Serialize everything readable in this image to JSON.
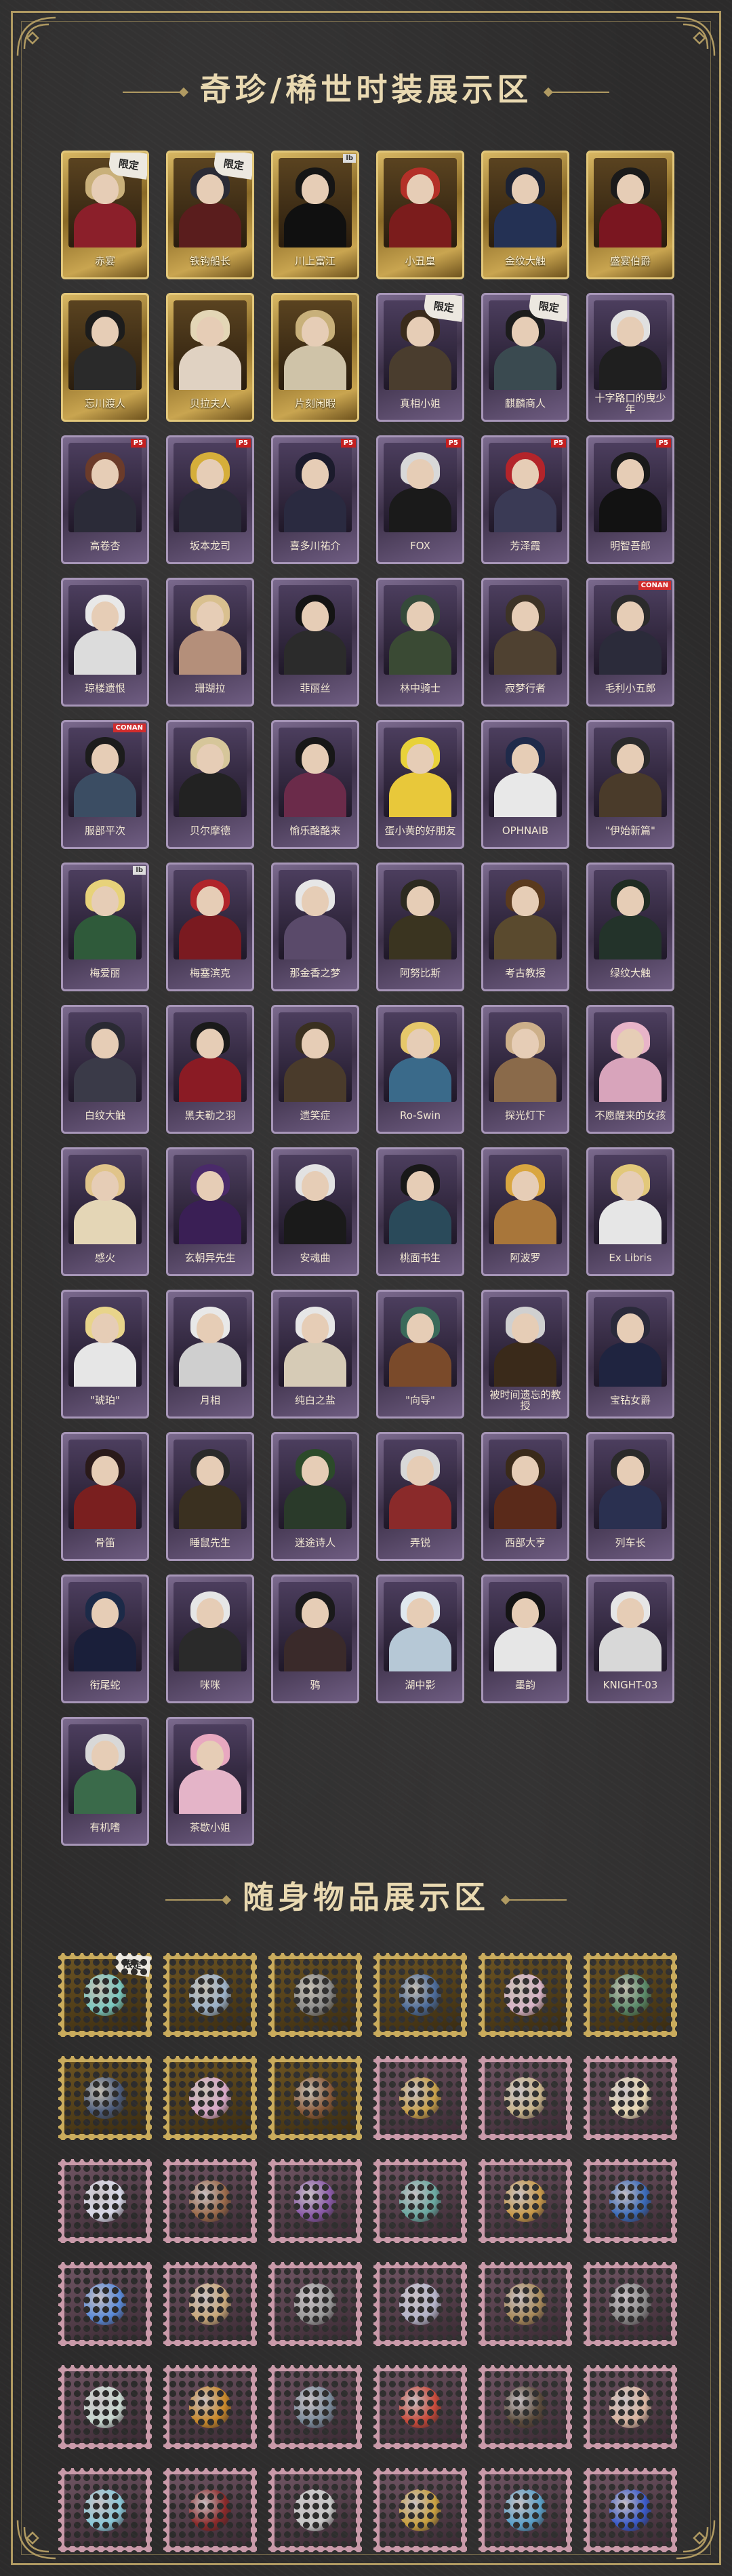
{
  "costumes_section": {
    "title": "奇珍/稀世时装展示区"
  },
  "items_section": {
    "title": "随身物品展示区"
  },
  "limited_tag": "限定",
  "badge_texts": {
    "p5": "P5",
    "conan": "CONAN",
    "lb": "lb"
  },
  "costumes": [
    {
      "name": "赤宴",
      "frame": "gold",
      "limited": true,
      "hair": "#c9b07a",
      "body": "#8b1f2a"
    },
    {
      "name": "铁钩船长",
      "frame": "gold",
      "limited": true,
      "hair": "#2b2b36",
      "body": "#5a1d1d"
    },
    {
      "name": "川上富江",
      "frame": "gold",
      "limited": false,
      "hair": "#151515",
      "body": "#101010",
      "badge": "lb"
    },
    {
      "name": "小丑皇",
      "frame": "gold",
      "limited": false,
      "hair": "#b33028",
      "body": "#7b1c1c"
    },
    {
      "name": "金纹大触",
      "frame": "gold",
      "limited": false,
      "hair": "#1c2233",
      "body": "#243154"
    },
    {
      "name": "盛宴伯爵",
      "frame": "gold",
      "limited": false,
      "hair": "#1a1a1a",
      "body": "#7a1620"
    },
    {
      "name": "忘川渡人",
      "frame": "gold",
      "limited": false,
      "hair": "#1c1c1c",
      "body": "#2a2a2a"
    },
    {
      "name": "贝拉夫人",
      "frame": "gold",
      "limited": false,
      "hair": "#e3d6b6",
      "body": "#e0d2c2"
    },
    {
      "name": "片刻闲暇",
      "frame": "gold",
      "limited": false,
      "hair": "#c8b07a",
      "body": "#cfc3a8"
    },
    {
      "name": "真相小姐",
      "frame": "purple",
      "limited": true,
      "hair": "#3a2b1c",
      "body": "#4a3d2e"
    },
    {
      "name": "麒麟商人",
      "frame": "purple",
      "limited": true,
      "hair": "#1c1c1c",
      "body": "#3a4a50"
    },
    {
      "name": "十字路口的曳少年",
      "frame": "purple",
      "limited": false,
      "hair": "#e0e0e0",
      "body": "#1f1f1f"
    },
    {
      "name": "高卷杏",
      "frame": "purple",
      "limited": false,
      "hair": "#6b3b2a",
      "body": "#2b2b38",
      "badge": "p5"
    },
    {
      "name": "坂本龙司",
      "frame": "purple",
      "limited": false,
      "hair": "#d5ae3a",
      "body": "#2a2a38",
      "badge": "p5"
    },
    {
      "name": "喜多川祐介",
      "frame": "purple",
      "limited": false,
      "hair": "#1b1b2c",
      "body": "#2a2a40",
      "badge": "p5"
    },
    {
      "name": "FOX",
      "frame": "purple",
      "limited": false,
      "hair": "#d8d8d8",
      "body": "#1a1a1a",
      "badge": "p5"
    },
    {
      "name": "芳泽霞",
      "frame": "purple",
      "limited": false,
      "hair": "#b3242a",
      "body": "#3a3a55",
      "badge": "p5"
    },
    {
      "name": "明智吾郎",
      "frame": "purple",
      "limited": false,
      "hair": "#1a1a1a",
      "body": "#121212",
      "badge": "p5"
    },
    {
      "name": "琼楼遗恨",
      "frame": "purple",
      "limited": false,
      "hair": "#e8e8e8",
      "body": "#dcdcdc"
    },
    {
      "name": "珊瑚拉",
      "frame": "purple",
      "limited": false,
      "hair": "#d9c08f",
      "body": "#b48f7a"
    },
    {
      "name": "菲丽丝",
      "frame": "purple",
      "limited": false,
      "hair": "#141414",
      "body": "#2b2b2b"
    },
    {
      "name": "林中骑士",
      "frame": "purple",
      "limited": false,
      "hair": "#354a3a",
      "body": "#3a4a34"
    },
    {
      "name": "寂梦行者",
      "frame": "purple",
      "limited": false,
      "hair": "#3d3326",
      "body": "#4f4131"
    },
    {
      "name": "毛利小五郎",
      "frame": "purple",
      "limited": false,
      "hair": "#2b2b2b",
      "body": "#2b2b3a",
      "badge": "conan"
    },
    {
      "name": "服部平次",
      "frame": "purple",
      "limited": false,
      "hair": "#1c1c1c",
      "body": "#3b4d63",
      "badge": "conan"
    },
    {
      "name": "贝尔摩德",
      "frame": "purple",
      "limited": false,
      "hair": "#d6c69a",
      "body": "#222222"
    },
    {
      "name": "愉乐酪酪来",
      "frame": "purple",
      "limited": false,
      "hair": "#171717",
      "body": "#6b2b4a"
    },
    {
      "name": "蛋小黄的好朋友",
      "frame": "purple",
      "limited": false,
      "hair": "#e8d23a",
      "body": "#e8c83a"
    },
    {
      "name": "OPHNAIB",
      "frame": "purple",
      "limited": false,
      "hair": "#1f2a4a",
      "body": "#e8e8e8"
    },
    {
      "name": "\"伊始新篇\"",
      "frame": "purple",
      "limited": false,
      "hair": "#2a2a2a",
      "body": "#4a3b2a"
    },
    {
      "name": "梅爱丽",
      "frame": "purple",
      "limited": false,
      "hair": "#e7d27a",
      "body": "#2f5a3a",
      "badge": "lb"
    },
    {
      "name": "梅塞滨克",
      "frame": "purple",
      "limited": false,
      "hair": "#b0242a",
      "body": "#7a1a20"
    },
    {
      "name": "那金香之梦",
      "frame": "purple",
      "limited": false,
      "hair": "#e6e6e6",
      "body": "#5a4a6a"
    },
    {
      "name": "阿努比斯",
      "frame": "purple",
      "limited": false,
      "hair": "#2c2a20",
      "body": "#3a3420"
    },
    {
      "name": "考古教授",
      "frame": "purple",
      "limited": false,
      "hair": "#5a3a1e",
      "body": "#5a4a2e"
    },
    {
      "name": "绿纹大触",
      "frame": "purple",
      "limited": false,
      "hair": "#1f2c22",
      "body": "#23332a"
    },
    {
      "name": "白纹大触",
      "frame": "purple",
      "limited": false,
      "hair": "#2a2a33",
      "body": "#3a3a48"
    },
    {
      "name": "黑夫勒之羽",
      "frame": "purple",
      "limited": false,
      "hair": "#1a1a1a",
      "body": "#8a1b24"
    },
    {
      "name": "遗笑症",
      "frame": "purple",
      "limited": false,
      "hair": "#3a3020",
      "body": "#4a3b2b"
    },
    {
      "name": "Ro-Swin",
      "frame": "purple",
      "limited": false,
      "hair": "#e6c86a",
      "body": "#3a6a8a"
    },
    {
      "name": "探光灯下",
      "frame": "purple",
      "limited": false,
      "hair": "#cdb08a",
      "body": "#8a6a4a"
    },
    {
      "name": "不愿醒来的女孩",
      "frame": "purple",
      "limited": false,
      "hair": "#e8b4c8",
      "body": "#d8a4bb"
    },
    {
      "name": "感火",
      "frame": "purple",
      "limited": false,
      "hair": "#e0c48a",
      "body": "#e4d6b6"
    },
    {
      "name": "玄朝异先生",
      "frame": "purple",
      "limited": false,
      "hair": "#4a2a6a",
      "body": "#3a1f55"
    },
    {
      "name": "安魂曲",
      "frame": "purple",
      "limited": false,
      "hair": "#e2e2e2",
      "body": "#1a1a1a"
    },
    {
      "name": "桃面书生",
      "frame": "purple",
      "limited": false,
      "hair": "#181818",
      "body": "#2a4a5a"
    },
    {
      "name": "阿波罗",
      "frame": "purple",
      "limited": false,
      "hair": "#d9a640",
      "body": "#a8763a"
    },
    {
      "name": "Ex Libris",
      "frame": "purple",
      "limited": false,
      "hair": "#e2c87a",
      "body": "#e6e6e6"
    },
    {
      "name": "\"琥珀\"",
      "frame": "purple",
      "limited": false,
      "hair": "#e8d48a",
      "body": "#e6e6e6"
    },
    {
      "name": "月相",
      "frame": "purple",
      "limited": false,
      "hair": "#e8e8e8",
      "body": "#cfcfcf"
    },
    {
      "name": "纯白之盐",
      "frame": "purple",
      "limited": false,
      "hair": "#e6e6e6",
      "body": "#d6cbb6"
    },
    {
      "name": "\"向导\"",
      "frame": "purple",
      "limited": false,
      "hair": "#3a6a5a",
      "body": "#7a4a2a"
    },
    {
      "name": "被时间遗忘的教授",
      "frame": "purple",
      "limited": false,
      "hair": "#d0d0d0",
      "body": "#3a2a1a"
    },
    {
      "name": "宝钻女爵",
      "frame": "purple",
      "limited": false,
      "hair": "#2a2a3a",
      "body": "#1f2440"
    },
    {
      "name": "骨笛",
      "frame": "purple",
      "limited": false,
      "hair": "#2a1a1a",
      "body": "#7a1f1f"
    },
    {
      "name": "睡鼠先生",
      "frame": "purple",
      "limited": false,
      "hair": "#2a2a2a",
      "body": "#3a3020"
    },
    {
      "name": "迷途诗人",
      "frame": "purple",
      "limited": false,
      "hair": "#2c4a2a",
      "body": "#2a3a2a"
    },
    {
      "name": "弄锐",
      "frame": "purple",
      "limited": false,
      "hair": "#d8d8d8",
      "body": "#8a2a2a"
    },
    {
      "name": "西部大亨",
      "frame": "purple",
      "limited": false,
      "hair": "#3a2a1a",
      "body": "#5a2a1a"
    },
    {
      "name": "列车长",
      "frame": "purple",
      "limited": false,
      "hair": "#2a2a2a",
      "body": "#2a3050"
    },
    {
      "name": "衔尾蛇",
      "frame": "purple",
      "limited": false,
      "hair": "#1c2a48",
      "body": "#1a1f3a"
    },
    {
      "name": "咪咪",
      "frame": "purple",
      "limited": false,
      "hair": "#e6e6e6",
      "body": "#2a2a2a"
    },
    {
      "name": "鸦",
      "frame": "purple",
      "limited": false,
      "hair": "#1a1a1a",
      "body": "#3a2a2a"
    },
    {
      "name": "湖中影",
      "frame": "purple",
      "limited": false,
      "hair": "#e0e8ee",
      "body": "#b6c8d6"
    },
    {
      "name": "墨韵",
      "frame": "purple",
      "limited": false,
      "hair": "#141414",
      "body": "#e6e6e6"
    },
    {
      "name": "KNIGHT-03",
      "frame": "purple",
      "limited": false,
      "hair": "#e6e6e6",
      "body": "#d8d8d8"
    },
    {
      "name": "有机嗜",
      "frame": "purple",
      "limited": false,
      "hair": "#d8d8d8",
      "body": "#3a6a4a"
    },
    {
      "name": "茶歇小姐",
      "frame": "purple",
      "limited": false,
      "hair": "#e8a8c0",
      "body": "#e4b4c8"
    }
  ],
  "items": [
    {
      "frame": "gold",
      "limited": true,
      "icon": "#7ac8c0"
    },
    {
      "frame": "gold",
      "limited": false,
      "icon": "#9ab0c8"
    },
    {
      "frame": "gold",
      "limited": false,
      "icon": "#8a8a8a"
    },
    {
      "frame": "gold",
      "limited": false,
      "icon": "#4a6a9a"
    },
    {
      "frame": "gold",
      "limited": false,
      "icon": "#d8b4c8"
    },
    {
      "frame": "gold",
      "limited": false,
      "icon": "#5a8a6a"
    },
    {
      "frame": "gold",
      "limited": false,
      "icon": "#4a5a7a"
    },
    {
      "frame": "gold",
      "limited": false,
      "icon": "#d8a8c8"
    },
    {
      "frame": "gold",
      "limited": false,
      "icon": "#8a5a3a"
    },
    {
      "frame": "pink",
      "limited": false,
      "icon": "#c8a04a"
    },
    {
      "frame": "pink",
      "limited": false,
      "icon": "#c8b48a"
    },
    {
      "frame": "pink",
      "limited": false,
      "icon": "#e8d8b4"
    },
    {
      "frame": "pink",
      "limited": false,
      "icon": "#d8d8e8"
    },
    {
      "frame": "pink",
      "limited": false,
      "icon": "#9a6a4a"
    },
    {
      "frame": "pink",
      "limited": false,
      "icon": "#8a5aa8"
    },
    {
      "frame": "pink",
      "limited": false,
      "icon": "#6aa8a0"
    },
    {
      "frame": "pink",
      "limited": false,
      "icon": "#c89a4a"
    },
    {
      "frame": "pink",
      "limited": false,
      "icon": "#3a6ab8"
    },
    {
      "frame": "pink",
      "limited": false,
      "icon": "#5a8ad8"
    },
    {
      "frame": "pink",
      "limited": false,
      "icon": "#c8a87a"
    },
    {
      "frame": "pink",
      "limited": false,
      "icon": "#9a9a9a"
    },
    {
      "frame": "pink",
      "limited": false,
      "icon": "#b4b4c8"
    },
    {
      "frame": "pink",
      "limited": false,
      "icon": "#a88a5a"
    },
    {
      "frame": "pink",
      "limited": false,
      "icon": "#8a8a8a"
    },
    {
      "frame": "pink",
      "limited": false,
      "icon": "#c8d8d0"
    },
    {
      "frame": "pink",
      "limited": false,
      "icon": "#c8882a"
    },
    {
      "frame": "pink",
      "limited": false,
      "icon": "#7a8a9a"
    },
    {
      "frame": "pink",
      "limited": false,
      "icon": "#c84a3a"
    },
    {
      "frame": "pink",
      "limited": false,
      "icon": "#5a4a3a"
    },
    {
      "frame": "pink",
      "limited": false,
      "icon": "#d8b4a0"
    },
    {
      "frame": "pink",
      "limited": false,
      "icon": "#8ac8d8"
    },
    {
      "frame": "pink",
      "limited": false,
      "icon": "#8a2a2a"
    },
    {
      "frame": "pink",
      "limited": false,
      "icon": "#c8c8c8"
    },
    {
      "frame": "pink",
      "limited": false,
      "icon": "#c8a040"
    },
    {
      "frame": "pink",
      "limited": false,
      "icon": "#5aa0c8"
    },
    {
      "frame": "pink",
      "limited": false,
      "icon": "#3a5ac8"
    }
  ]
}
